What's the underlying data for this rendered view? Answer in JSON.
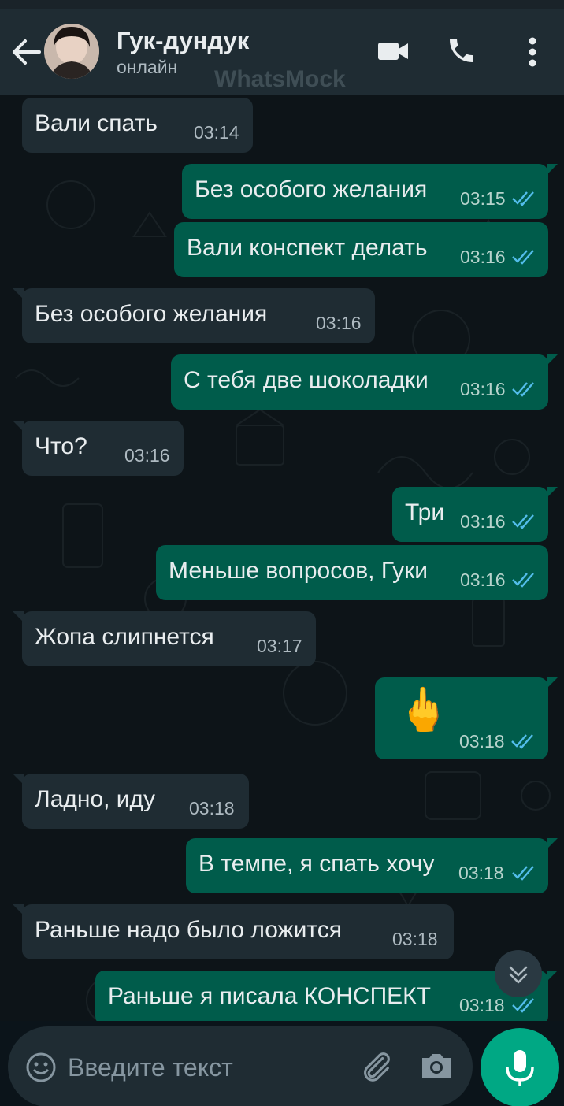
{
  "header": {
    "contact_name": "Гук-дундук",
    "contact_status": "онлайн",
    "watermark": "WhatsMock"
  },
  "messages": [
    {
      "direction": "in",
      "text": "Вали спать",
      "time": "03:14"
    },
    {
      "direction": "out",
      "text": "Без особого желания",
      "time": "03:15",
      "read": true
    },
    {
      "direction": "out",
      "text": "Вали конспект делать",
      "time": "03:16",
      "read": true
    },
    {
      "direction": "in",
      "text": "Без особого желания",
      "time": "03:16"
    },
    {
      "direction": "out",
      "text": "С тебя две шоколадки",
      "time": "03:16",
      "read": true
    },
    {
      "direction": "in",
      "text": "Что?",
      "time": "03:16"
    },
    {
      "direction": "out",
      "text": "Три",
      "time": "03:16",
      "read": true
    },
    {
      "direction": "out",
      "text": "Меньше вопросов, Гуки",
      "time": "03:16",
      "read": true
    },
    {
      "direction": "in",
      "text": "Жопа слипнется",
      "time": "03:17"
    },
    {
      "direction": "out",
      "text": "🖕",
      "time": "03:18",
      "read": true
    },
    {
      "direction": "in",
      "text": "Ладно, иду",
      "time": "03:18"
    },
    {
      "direction": "out",
      "text": "В темпе, я спать хочу",
      "time": "03:18",
      "read": true
    },
    {
      "direction": "in",
      "text": "Раньше надо было ложится",
      "time": "03:18"
    },
    {
      "direction": "out",
      "text": "Раньше я писала КОНСПЕКТ",
      "time": "03:18",
      "read": true
    }
  ],
  "composer": {
    "placeholder": "Введите текст"
  },
  "colors": {
    "header_bg": "#1f2c33",
    "chat_bg": "#0d1418",
    "incoming_bubble": "#1f2c33",
    "outgoing_bubble": "#005c4b",
    "read_ticks": "#53bdeb",
    "accent": "#00a884"
  },
  "icons": {
    "back": "arrow-left-icon",
    "video": "video-camera-icon",
    "call": "phone-icon",
    "menu": "more-vert-icon",
    "scroll": "chevron-double-down-icon",
    "emoji": "emoji-icon",
    "attach": "paperclip-icon",
    "camera": "camera-icon",
    "mic": "microphone-icon"
  }
}
